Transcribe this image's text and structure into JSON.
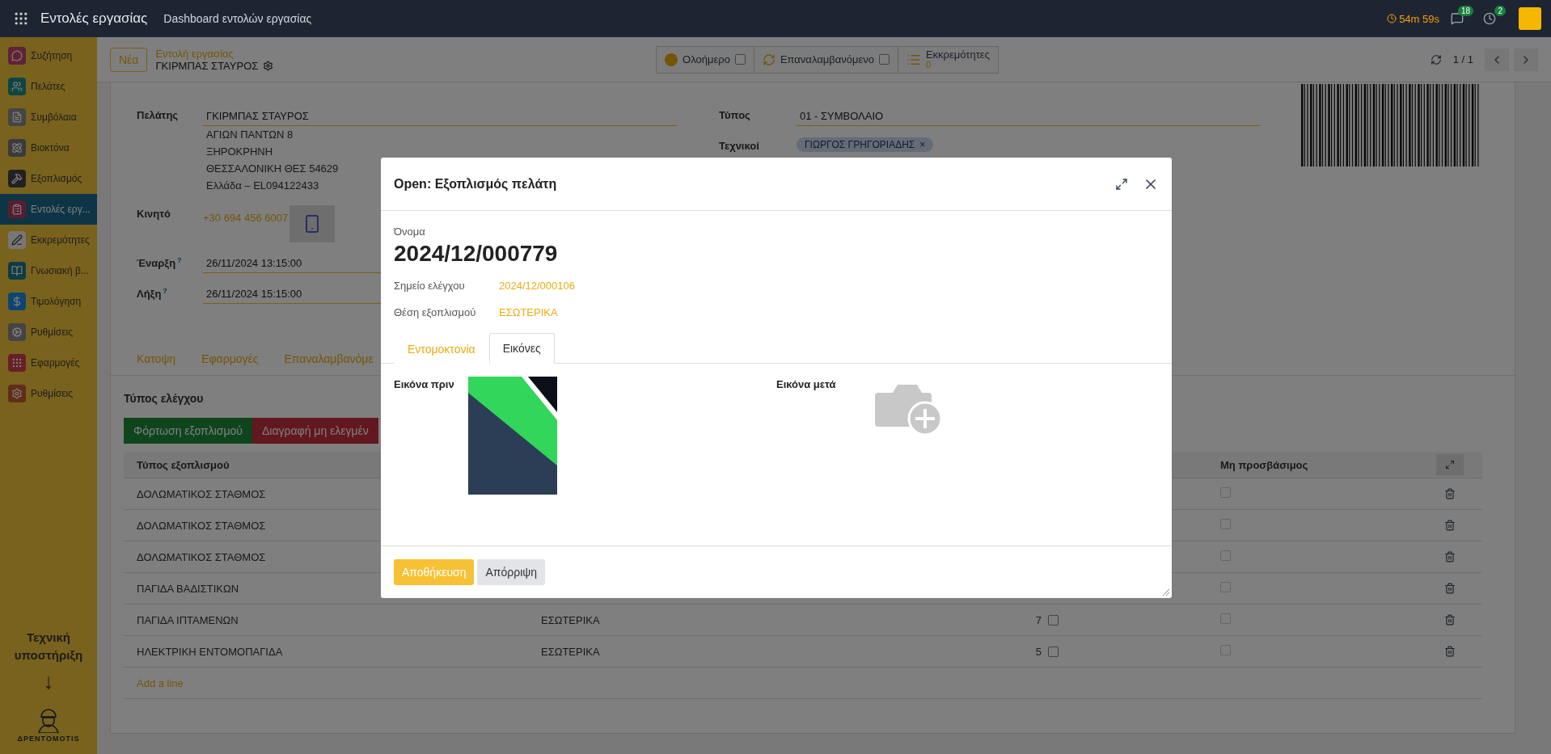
{
  "navbar": {
    "app_title": "Εντολές εργασίας",
    "menu": "Dashboard εντολών εργασίας",
    "timer": "54m 59s",
    "messages_badge": "18",
    "activities_badge": "2"
  },
  "sidebar": {
    "items": [
      {
        "label": "Συζήτηση",
        "kind": "chat",
        "selected": false
      },
      {
        "label": "Πελάτες",
        "kind": "people",
        "selected": false
      },
      {
        "label": "Συμβόλαια",
        "kind": "contract",
        "selected": false
      },
      {
        "label": "Βιοκτόνα",
        "kind": "molecule",
        "selected": false
      },
      {
        "label": "Εξοπλισμός",
        "kind": "tools",
        "selected": false
      },
      {
        "label": "Εντολές εργ...",
        "kind": "orders",
        "selected": true
      },
      {
        "label": "Εκκρεμότητες",
        "kind": "pen",
        "selected": false
      },
      {
        "label": "Γνωσιακή β...",
        "kind": "book",
        "selected": false
      },
      {
        "label": "Τιμολόγηση",
        "kind": "invoice",
        "selected": false
      },
      {
        "label": "Ρυθμίσεις",
        "kind": "gear",
        "selected": false
      },
      {
        "label": "Εφαρμογές",
        "kind": "apps",
        "selected": false
      },
      {
        "label": "Ρυθμίσεις",
        "kind": "brand",
        "selected": false
      }
    ],
    "support": "Τεχνική υποστήριξη",
    "arrow": "↓",
    "logo_text": "ΔΡΕΝΤΟΜΟΤΙS"
  },
  "control_panel": {
    "new_button": "Νέα",
    "breadcrumb": "Εντολή εργασίας",
    "record": "ΓΚΙΡΜΠΑΣ ΣΤΑΥΡΟΣ",
    "toggles": [
      {
        "label": "Ολοήμερο",
        "kind": "dot",
        "checked": false
      },
      {
        "label": "Επαναλαμβανόμενο",
        "kind": "repeat",
        "checked": false
      }
    ],
    "pending": {
      "label": "Εκκρεμότητες",
      "count": "0"
    },
    "pager": "1 / 1"
  },
  "form": {
    "left_fields": [
      {
        "label": "Πελάτης",
        "value": "ΓΚΙΡΜΠΑΣ ΣΤΑΥΡΟΣ",
        "kind": "input",
        "address": [
          "ΑΓΙΩΝ ΠΑΝΤΩΝ 8",
          "ΞΗΡΟΚΡΗΝΗ",
          "ΘΕΣΣΑΛΟΝΙΚΗ ΘΕΣ 54629",
          "Ελλάδα – EL094122433"
        ]
      },
      {
        "label": "Κινητό",
        "value": "+30 694 456 6007",
        "kind": "phone"
      },
      {
        "label": "Έναρξη",
        "help": "?",
        "value": "26/11/2024 13:15:00",
        "kind": "input"
      },
      {
        "label": "Λήξη",
        "help": "?",
        "value": "26/11/2024 15:15:00",
        "kind": "input"
      }
    ],
    "right_fields": [
      {
        "label": "Τύπος",
        "value": "01 - ΣΥΜΒΟΛΑΙΟ",
        "kind": "input"
      },
      {
        "label": "Τεχνικοί",
        "value": "ΓΙΩΡΓΟΣ ΓΡΗΓΟΡΙΑΔΗΣ",
        "remove": "×",
        "kind": "tag"
      }
    ],
    "tabs": [
      {
        "label": "Κατοψη",
        "selected": false
      },
      {
        "label": "Εφαρμογές",
        "selected": false
      },
      {
        "label": "Επαναλαμβανόμε",
        "selected": false
      }
    ],
    "section_title": "Τύπος ελέγχου",
    "buttons": [
      {
        "label": "Φόρτωση εξοπλισμού",
        "kind": "success"
      },
      {
        "label": "Διαγραφή μη ελεγμέν",
        "kind": "danger"
      }
    ],
    "table": {
      "columns": [
        {
          "label": "Τύπος εξοπλισμού"
        },
        {
          "label": "Μη προσβάσιμος"
        }
      ],
      "rows": [
        {
          "type": "ΔΟΛΩΜΑΤΙΚΟΣ ΣΤΑΘΜΟΣ",
          "inaccessible": false
        },
        {
          "type": "ΔΟΛΩΜΑΤΙΚΟΣ ΣΤΑΘΜΟΣ",
          "inaccessible": false
        },
        {
          "type": "ΔΟΛΩΜΑΤΙΚΟΣ ΣΤΑΘΜΟΣ",
          "inaccessible": false
        },
        {
          "type": "ΠΑΓΙΔΑ ΒΑΔΙΣΤΙΚΩΝ",
          "inaccessible": false
        },
        {
          "type": "ΠΑΓΙΔΑ ΙΠΤΑΜΕΝΩΝ",
          "position": "ΕΣΩΤΕΡΙΚΑ",
          "count": "7",
          "checked": false,
          "inaccessible": false
        },
        {
          "type": "ΗΛΕΚΤΡΙΚΗ ΕΝΤΟΜΟΠΑΓΙΔΑ",
          "position": "ΕΣΩΤΕΡΙΚΑ",
          "count": "5",
          "checked": false,
          "inaccessible": false
        }
      ],
      "add_line": "Add a line"
    }
  },
  "dialog": {
    "title": "Open: Εξοπλισμός πελάτη",
    "name_label": "Όνομα",
    "name": "2024/12/000779",
    "fields": [
      {
        "label": "Σημείο ελέγχου",
        "value": "2024/12/000106"
      },
      {
        "label": "Θέση εξοπλισμού",
        "value": "ΕΣΩΤΕΡΙΚΑ"
      }
    ],
    "tabs": [
      {
        "label": "Εντομοκτονία",
        "selected": false
      },
      {
        "label": "Εικόνες",
        "selected": true
      }
    ],
    "images": [
      {
        "label": "Εικόνα πριν",
        "kind": "photo"
      },
      {
        "label": "Εικόνα μετά",
        "kind": "empty"
      }
    ],
    "buttons": [
      {
        "label": "Αποθήκευση",
        "kind": "primary"
      },
      {
        "label": "Απόρριψη",
        "kind": "secondary"
      }
    ]
  }
}
